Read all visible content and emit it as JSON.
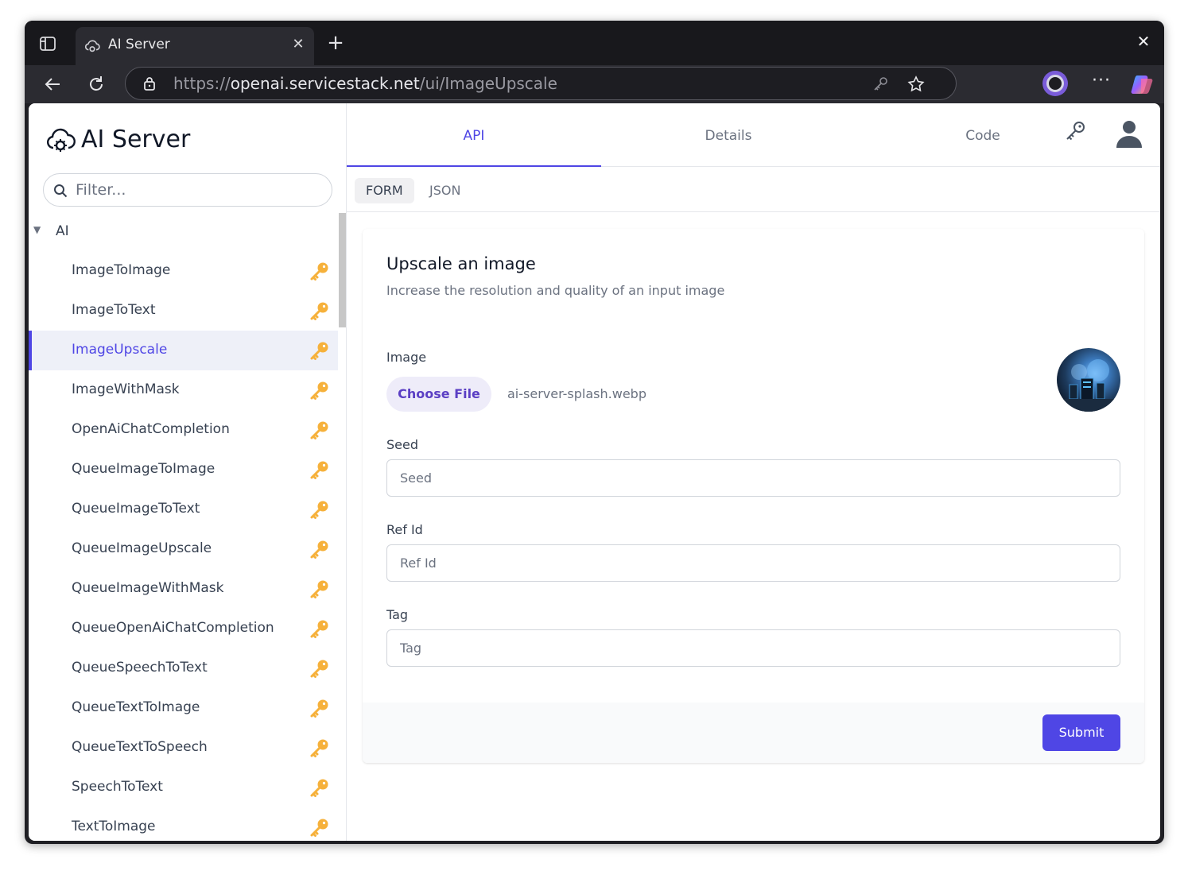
{
  "browser": {
    "tab_title": "AI Server",
    "url_scheme": "https://",
    "url_host": "openai.servicestack.net",
    "url_path": "/ui/ImageUpscale"
  },
  "sidebar": {
    "brand": "AI Server",
    "filter_placeholder": "Filter...",
    "group": "AI",
    "items": [
      {
        "label": "ImageToImage",
        "active": false
      },
      {
        "label": "ImageToText",
        "active": false
      },
      {
        "label": "ImageUpscale",
        "active": true
      },
      {
        "label": "ImageWithMask",
        "active": false
      },
      {
        "label": "OpenAiChatCompletion",
        "active": false
      },
      {
        "label": "QueueImageToImage",
        "active": false
      },
      {
        "label": "QueueImageToText",
        "active": false
      },
      {
        "label": "QueueImageUpscale",
        "active": false
      },
      {
        "label": "QueueImageWithMask",
        "active": false
      },
      {
        "label": "QueueOpenAiChatCompletion",
        "active": false
      },
      {
        "label": "QueueSpeechToText",
        "active": false
      },
      {
        "label": "QueueTextToImage",
        "active": false
      },
      {
        "label": "QueueTextToSpeech",
        "active": false
      },
      {
        "label": "SpeechToText",
        "active": false
      },
      {
        "label": "TextToImage",
        "active": false
      }
    ]
  },
  "main": {
    "tabs": [
      "API",
      "Details",
      "Code"
    ],
    "active_tab": "API",
    "sub_tabs": [
      "FORM",
      "JSON"
    ],
    "active_sub_tab": "FORM",
    "form": {
      "title": "Upscale an image",
      "description": "Increase the resolution and quality of an input image",
      "image_label": "Image",
      "choose_file_label": "Choose File",
      "file_name": "ai-server-splash.webp",
      "seed_label": "Seed",
      "seed_placeholder": "Seed",
      "refid_label": "Ref Id",
      "refid_placeholder": "Ref Id",
      "tag_label": "Tag",
      "tag_placeholder": "Tag",
      "submit_label": "Submit"
    }
  },
  "colors": {
    "accent": "#4f46e5",
    "key_icon": "#f6b13b",
    "browser_chrome": "#2b2b31"
  },
  "icons": [
    "tab-actions-icon",
    "favicon-icon",
    "close-icon",
    "plus-icon",
    "back-icon",
    "reload-icon",
    "lock-icon",
    "key-icon",
    "star-icon",
    "profile-icon",
    "more-icon",
    "copilot-icon",
    "brand-cloud-icon",
    "search-icon",
    "caret-down-icon",
    "user-icon"
  ]
}
